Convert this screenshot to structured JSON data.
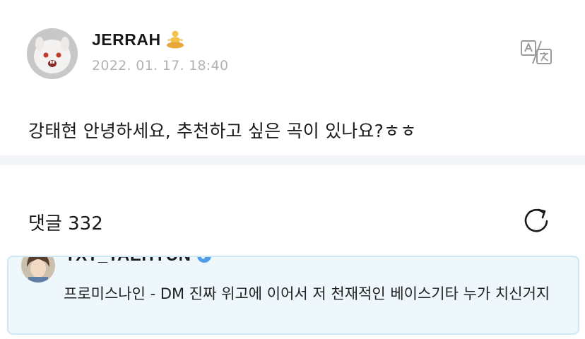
{
  "post": {
    "author_name": "JERRAH",
    "author_emoji": "person-in-lotus-position",
    "timestamp": "2022. 01. 17. 18:40",
    "body": "강태현 안녕하세요, 추천하고 싶은 곡이 있나요?ㅎㅎ",
    "translate_icon": "translate-icon"
  },
  "comments": {
    "header": "댓글 332",
    "refresh_icon": "refresh-icon",
    "items": [
      {
        "author": "TXT_TAEHYUN",
        "verified": true,
        "text": "프로미스나인 - DM 진짜 위고에 이어서 저 천재적인 베이스기타 누가 치신거지"
      }
    ]
  },
  "colors": {
    "timestamp": "#b3b3b3",
    "divider": "#f4f5f8",
    "comment_bg": "#eef7fc",
    "comment_border": "#cfe7f3",
    "verified": "#4f9ded"
  }
}
